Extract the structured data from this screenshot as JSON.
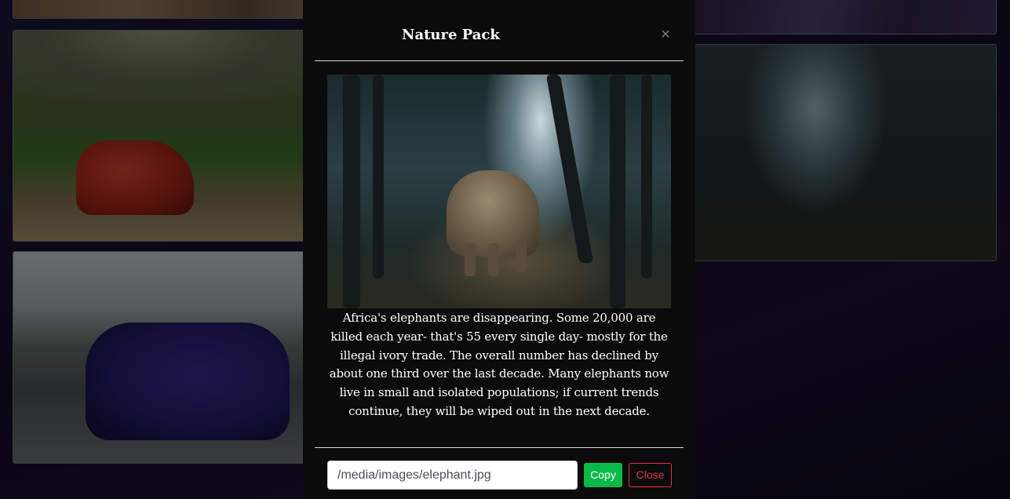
{
  "modal": {
    "title": "Nature Pack",
    "close_icon": "close-icon",
    "image_subject": "elephant-in-forest",
    "description": "Africa's elephants are disappearing. Some 20,000 are killed each year- that's 55 every single day- mostly for the illegal ivory trade. The overall number has declined by about one third over the last decade. Many elephants now live in small and isolated populations; if current trends continue, they will be wiped out in the next decade.",
    "path_value": "/media/images/elephant.jpg",
    "copy_label": "Copy",
    "close_label": "Close"
  },
  "colors": {
    "copy_button": "#0aba48",
    "close_button": "#dc3545",
    "modal_background": "#0b0b0b"
  }
}
